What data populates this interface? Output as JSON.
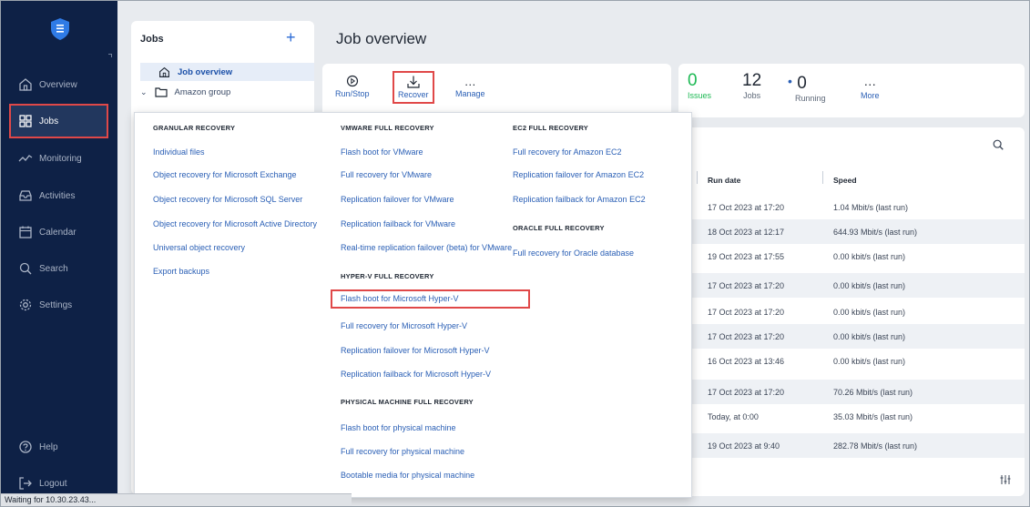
{
  "sidebar": {
    "items": [
      {
        "label": "Overview",
        "icon": "home-icon"
      },
      {
        "label": "Jobs",
        "icon": "grid-icon"
      },
      {
        "label": "Monitoring",
        "icon": "pulse-icon"
      },
      {
        "label": "Activities",
        "icon": "inbox-icon"
      },
      {
        "label": "Calendar",
        "icon": "calendar-icon"
      },
      {
        "label": "Search",
        "icon": "search-icon"
      },
      {
        "label": "Settings",
        "icon": "gear-icon"
      },
      {
        "label": "Help",
        "icon": "help-icon"
      },
      {
        "label": "Logout",
        "icon": "logout-icon"
      }
    ]
  },
  "jobs_panel": {
    "title": "Jobs",
    "add_label": "+",
    "tree": {
      "overview": "Job overview",
      "group": "Amazon group"
    }
  },
  "page": {
    "title": "Job overview"
  },
  "toolbar": {
    "run_stop": "Run/Stop",
    "recover": "Recover",
    "manage": "Manage",
    "manage_icon": "…"
  },
  "stats": {
    "issues_value": "0",
    "issues_label": "Issues",
    "jobs_value": "12",
    "jobs_label": "Jobs",
    "running_value": "0",
    "running_label": "Running",
    "more_icon": "…",
    "more_label": "More"
  },
  "table": {
    "columns": {
      "run_date": "Run date",
      "speed": "Speed"
    },
    "rows": [
      {
        "run_date": "17 Oct 2023 at 17:20",
        "speed": "1.04 Mbit/s (last run)"
      },
      {
        "run_date": "18 Oct 2023 at 12:17",
        "speed": "644.93 Mbit/s (last run)"
      },
      {
        "run_date": "19 Oct 2023 at 17:55",
        "speed": "0.00 kbit/s (last run)"
      },
      {
        "run_date": "17 Oct 2023 at 17:20",
        "speed": "0.00 kbit/s (last run)"
      },
      {
        "run_date": "17 Oct 2023 at 17:20",
        "speed": "0.00 kbit/s (last run)"
      },
      {
        "run_date": "17 Oct 2023 at 17:20",
        "speed": "0.00 kbit/s (last run)"
      },
      {
        "run_date": "16 Oct 2023 at 13:46",
        "speed": "0.00 kbit/s (last run)"
      },
      {
        "run_date": "17 Oct 2023 at 17:20",
        "speed": "70.26 Mbit/s (last run)"
      },
      {
        "run_date": "Today, at 0:00",
        "speed": "35.03 Mbit/s (last run)"
      },
      {
        "run_date": "19 Oct 2023 at 9:40",
        "speed": "282.78 Mbit/s (last run)"
      }
    ]
  },
  "recover_menu": {
    "granular": {
      "heading": "GRANULAR RECOVERY",
      "items": [
        "Individual files",
        "Object recovery for Microsoft Exchange",
        "Object recovery for Microsoft SQL Server",
        "Object recovery for Microsoft Active Directory",
        "Universal object recovery",
        "Export backups"
      ]
    },
    "vmware": {
      "heading": "VMWARE FULL RECOVERY",
      "items": [
        "Flash boot for VMware",
        "Full recovery for VMware",
        "Replication failover for VMware",
        "Replication failback for VMware",
        "Real-time replication failover (beta) for VMware"
      ]
    },
    "hyperv": {
      "heading": "HYPER-V FULL RECOVERY",
      "items": [
        "Flash boot for Microsoft Hyper-V",
        "Full recovery for Microsoft Hyper-V",
        "Replication failover for Microsoft Hyper-V",
        "Replication failback for Microsoft Hyper-V"
      ]
    },
    "physical": {
      "heading": "PHYSICAL MACHINE FULL RECOVERY",
      "items": [
        "Flash boot for physical machine",
        "Full recovery for physical machine",
        "Bootable media for physical machine"
      ]
    },
    "ec2": {
      "heading": "EC2 FULL RECOVERY",
      "items": [
        "Full recovery for Amazon EC2",
        "Replication failover for Amazon EC2",
        "Replication failback for Amazon EC2"
      ]
    },
    "oracle": {
      "heading": "ORACLE FULL RECOVERY",
      "items": [
        "Full recovery for Oracle database"
      ]
    }
  },
  "statusbar": {
    "text": "Waiting for 10.30.23.43..."
  },
  "colors": {
    "sidebar_bg": "#0e2146",
    "accent": "#2a5fb5",
    "highlight_border": "#e04848",
    "issues_green": "#1db954"
  }
}
